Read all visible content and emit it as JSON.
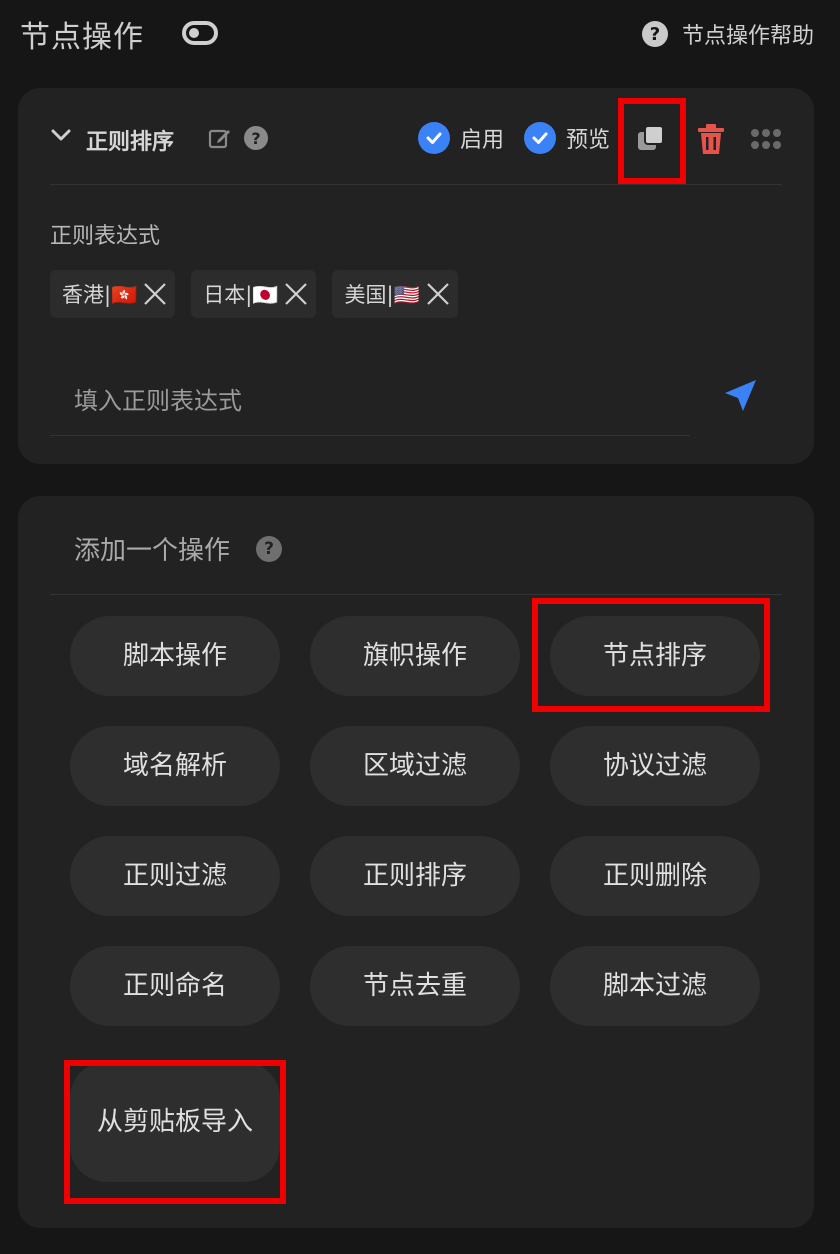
{
  "header": {
    "title": "节点操作",
    "help_label": "节点操作帮助"
  },
  "operation": {
    "title": "正则排序",
    "enable_label": "启用",
    "preview_label": "预览",
    "field_label": "正则表达式",
    "tags": [
      "香港|🇭🇰",
      "日本|🇯🇵",
      "美国|🇺🇸"
    ],
    "input_placeholder": "填入正则表达式"
  },
  "add_action": {
    "title": "添加一个操作",
    "buttons": [
      "脚本操作",
      "旗帜操作",
      "节点排序",
      "域名解析",
      "区域过滤",
      "协议过滤",
      "正则过滤",
      "正则排序",
      "正则删除",
      "正则命名",
      "节点去重",
      "脚本过滤",
      "从剪贴板导入"
    ]
  },
  "colors": {
    "accent": "#3b82f6",
    "delete": "#e5534b",
    "highlight": "#f00000"
  }
}
